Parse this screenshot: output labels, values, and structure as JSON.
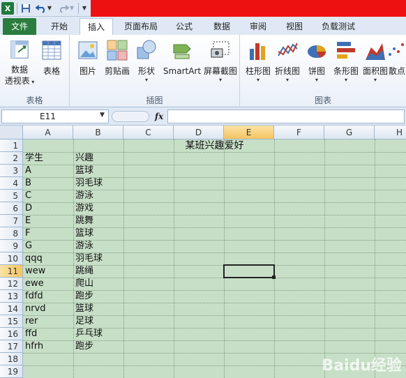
{
  "quick_access": {
    "excel_icon": "excel-logo-icon",
    "app_letter": "X"
  },
  "tabs": [
    {
      "label": "文件",
      "active": false
    },
    {
      "label": "开始",
      "active": false
    },
    {
      "label": "插入",
      "active": true
    },
    {
      "label": "页面布局",
      "active": false
    },
    {
      "label": "公式",
      "active": false
    },
    {
      "label": "数据",
      "active": false
    },
    {
      "label": "审阅",
      "active": false
    },
    {
      "label": "视图",
      "active": false
    },
    {
      "label": "负载测试",
      "active": false
    }
  ],
  "ribbon": {
    "groups": {
      "tables": "表格",
      "illustrations": "插图",
      "charts": "图表"
    },
    "buttons": {
      "pivot_line1": "数据",
      "pivot_line2": "透视表",
      "table": "表格",
      "picture": "图片",
      "clipart": "剪贴画",
      "shapes": "形状",
      "smartart": "SmartArt",
      "screenshot": "屏幕截图",
      "column_chart": "柱形图",
      "line_chart": "折线图",
      "pie_chart": "饼图",
      "bar_chart": "条形图",
      "area_chart": "面积图",
      "scatter_chart": "散点"
    }
  },
  "formula_bar": {
    "name_box": "E11",
    "fx_label": "fx",
    "formula": ""
  },
  "sheet": {
    "columns": [
      "A",
      "B",
      "C",
      "D",
      "E",
      "F",
      "G",
      "H"
    ],
    "rows": [
      "1",
      "2",
      "3",
      "4",
      "5",
      "6",
      "7",
      "8",
      "9",
      "10",
      "11",
      "12",
      "13",
      "14",
      "15",
      "16",
      "17",
      "18",
      "19"
    ],
    "active_cell": "E11",
    "title": "某班兴趣爱好",
    "data": [
      [
        "学生",
        "兴趣"
      ],
      [
        "A",
        "篮球"
      ],
      [
        "B",
        "羽毛球"
      ],
      [
        "C",
        "游泳"
      ],
      [
        "D",
        "游戏"
      ],
      [
        "E",
        "跳舞"
      ],
      [
        "F",
        "篮球"
      ],
      [
        "G",
        "游泳"
      ],
      [
        "qqq",
        "羽毛球"
      ],
      [
        "wew",
        "跳绳"
      ],
      [
        "ewe",
        "爬山"
      ],
      [
        "fdfd",
        "跑步"
      ],
      [
        "nrvd",
        "篮球"
      ],
      [
        "rer",
        "足球"
      ],
      [
        "ffd",
        "乒乓球"
      ],
      [
        "hfrh",
        "跑步"
      ]
    ]
  },
  "watermark": "Baidu经验",
  "colors": {
    "grid_bg": "#c7dfc7",
    "file_tab": "#2a7d3e",
    "title_red": "#ee1111"
  }
}
